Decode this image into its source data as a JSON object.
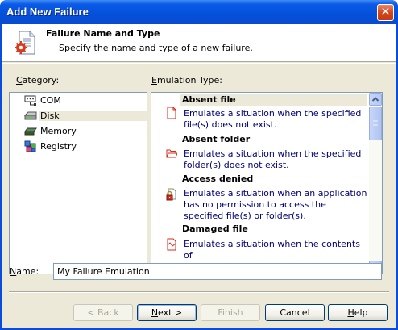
{
  "window": {
    "title": "Add New Failure",
    "close_glyph": "✕"
  },
  "header": {
    "title": "Failure Name and Type",
    "subtitle": "Specify the name and type of a new failure.",
    "icon": "document-gear-icon"
  },
  "category": {
    "label_prefix": "",
    "label_accel": "C",
    "label_rest": "ategory:",
    "items": [
      {
        "label": "COM",
        "icon": "com-icon",
        "selected": false
      },
      {
        "label": "Disk",
        "icon": "disk-icon",
        "selected": true
      },
      {
        "label": "Memory",
        "icon": "memory-icon",
        "selected": false
      },
      {
        "label": "Registry",
        "icon": "registry-icon",
        "selected": false
      }
    ]
  },
  "emulation": {
    "label_prefix": "",
    "label_accel": "E",
    "label_rest": "mulation Type:",
    "items": [
      {
        "title": "Absent file",
        "description": "Emulates a situation when the specified file(s) does not exist.",
        "icon": "blank-file-icon",
        "selected": true
      },
      {
        "title": "Absent folder",
        "description": "Emulates a situation when the specified folder(s) does not exist.",
        "icon": "folder-icon",
        "selected": false
      },
      {
        "title": "Access denied",
        "description": "Emulates a situation when an application has no permission to access the specified file(s) or folder(s).",
        "icon": "locked-file-icon",
        "selected": false
      },
      {
        "title": "Damaged file",
        "description": "Emulates a situation when the contents of",
        "icon": "damaged-file-icon",
        "selected": false
      }
    ]
  },
  "name_field": {
    "label_accel": "N",
    "label_rest": "ame:",
    "value": "My Failure Emulation"
  },
  "buttons": {
    "back": "< Back",
    "next_accel": "N",
    "next_rest": "ext >",
    "finish": "Finish",
    "cancel": "Cancel",
    "help_accel": "H",
    "help_rest": "elp"
  },
  "colors": {
    "title_bar": "#0450d9",
    "dialog_bg": "#ece9d8",
    "description_text": "#00007a",
    "close_button": "#d5461d"
  }
}
